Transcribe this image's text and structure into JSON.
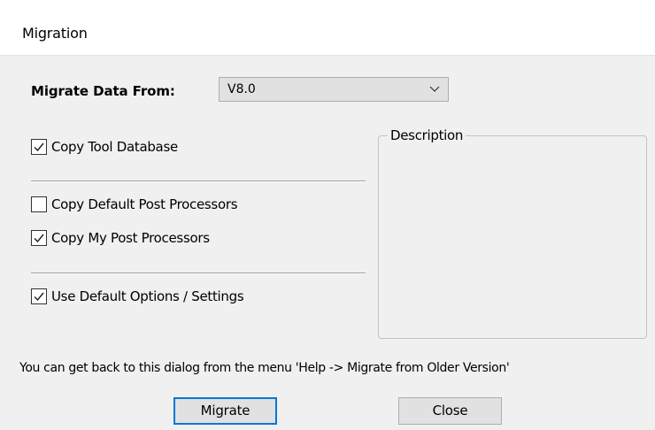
{
  "window": {
    "title": "Migration"
  },
  "migrate_from": {
    "label": "Migrate Data From:",
    "selected": "V8.0",
    "chevron_icon": "chevron-down-icon"
  },
  "options": [
    {
      "label": "Copy Tool Database",
      "checked": true
    },
    {
      "label": "Copy Default Post Processors",
      "checked": false
    },
    {
      "label": "Copy My Post Processors",
      "checked": true
    },
    {
      "label": "Use Default Options / Settings",
      "checked": true
    }
  ],
  "description": {
    "legend": "Description",
    "text": ""
  },
  "hint": "You can get back to this dialog from the menu 'Help -> Migrate from Older Version'",
  "buttons": {
    "migrate": "Migrate",
    "close": "Close"
  },
  "colors": {
    "accent": "#0078d7",
    "dialog_bg": "#f0f0f0",
    "title_bg": "#ffffff"
  }
}
